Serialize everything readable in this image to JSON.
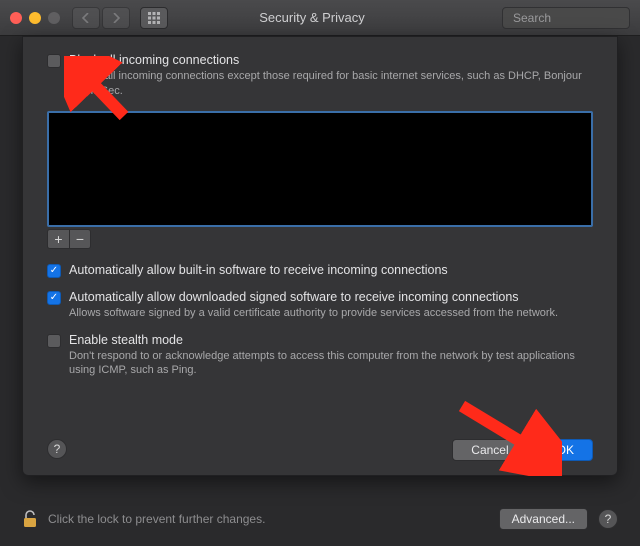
{
  "window": {
    "title": "Security & Privacy",
    "search_placeholder": "Search"
  },
  "sheet": {
    "block_all": {
      "label": "Block all incoming connections",
      "desc": "Blocks all incoming connections except those required for basic internet services, such as DHCP, Bonjour and IPSec.",
      "checked": false
    },
    "add_symbol": "+",
    "remove_symbol": "−",
    "auto_builtin": {
      "label": "Automatically allow built-in software to receive incoming connections",
      "checked": true
    },
    "auto_signed": {
      "label": "Automatically allow downloaded signed software to receive incoming connections",
      "desc": "Allows software signed by a valid certificate authority to provide services accessed from the network.",
      "checked": true
    },
    "stealth": {
      "label": "Enable stealth mode",
      "desc": "Don't respond to or acknowledge attempts to access this computer from the network by test applications using ICMP, such as Ping.",
      "checked": false
    },
    "help_symbol": "?",
    "cancel_label": "Cancel",
    "ok_label": "OK"
  },
  "footer": {
    "lock_text": "Click the lock to prevent further changes.",
    "advanced_label": "Advanced...",
    "help_symbol": "?"
  },
  "annotation": {
    "arrow_color": "#ff2a1a"
  }
}
